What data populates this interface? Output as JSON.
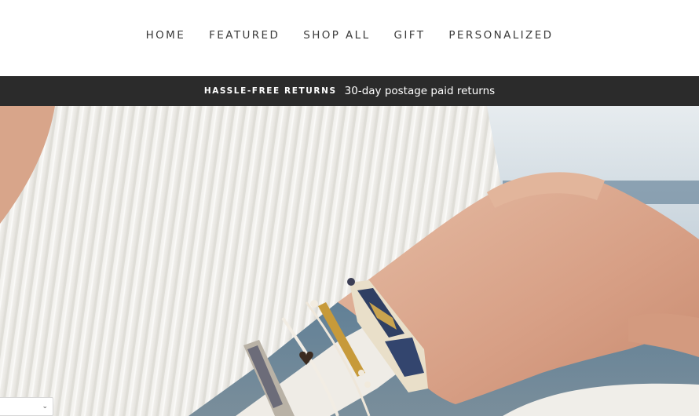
{
  "nav": {
    "items": [
      {
        "label": "HOME"
      },
      {
        "label": "FEATURED"
      },
      {
        "label": "SHOP ALL"
      },
      {
        "label": "GIFT"
      },
      {
        "label": "PERSONALIZED"
      }
    ]
  },
  "promo": {
    "strong": "HASSLE-FREE RETURNS",
    "text": "30-day postage paid returns"
  },
  "hero": {
    "icon": "hero-photo-image"
  },
  "currency_selector": {
    "icon": "chevron-down-icon"
  },
  "colors": {
    "promo_bg": "#2b2b2b",
    "nav_text": "#3a3a3a"
  }
}
